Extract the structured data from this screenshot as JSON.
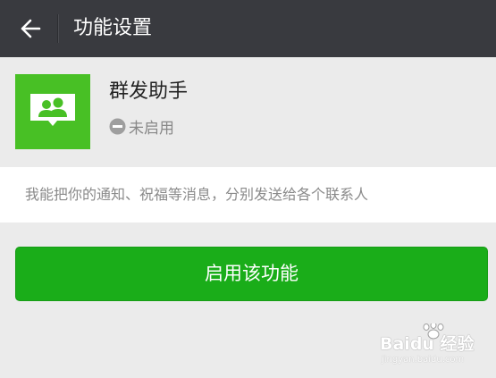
{
  "topbar": {
    "back_icon": "arrow-left-icon",
    "title": "功能设置"
  },
  "plugin": {
    "icon": "group-chat-icon",
    "name": "群发助手",
    "status_icon": "disabled-minus-icon",
    "status": "未启用"
  },
  "description": "我能把你的通知、祝福等消息，分别发送给各个联系人",
  "actions": {
    "enable_label": "启用该功能"
  },
  "watermark": {
    "brand": "Baidu 经验",
    "url": "jingyan.baidu.com"
  },
  "colors": {
    "topbar": "#393a3f",
    "background": "#ebebeb",
    "plugin_icon_bg": "#48c025",
    "primary_button": "#1aad19"
  }
}
